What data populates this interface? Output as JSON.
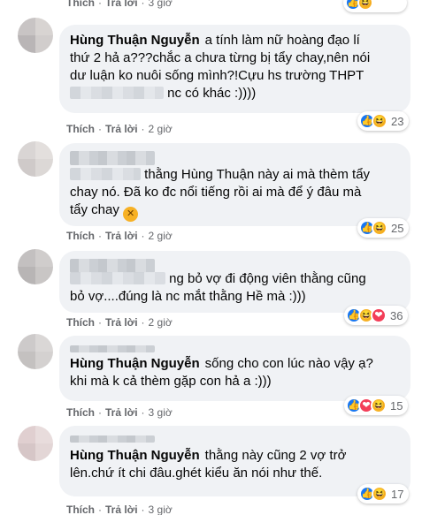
{
  "ui": {
    "like_label": "Thích",
    "reply_label": "Trả lời",
    "dot": "·",
    "time_label": "3 giờ",
    "time_label_2": "2 giờ"
  },
  "comments": [
    {
      "author": "Hùng Thuận Nguyễn",
      "line1": "a tính làm nữ hoàng đạo lí",
      "line2": "thứ 2 hả a???chắc a chưa từng bị tẩy chay,nên nói",
      "line3": "dư luận ko nuôi sống mình?!Cựu hs trường THPT",
      "line4": "nc có khác :))))",
      "reaction_count": "23",
      "time": "2 giờ"
    },
    {
      "author": "",
      "line1": "thằng Hùng Thuận này ai mà thèm tẩy",
      "line2": "chay nó. Đã ko đc nổi tiếng rồi ai mà để ý đâu mà",
      "line3": "tẩy chay",
      "reaction_count": "25",
      "time": "2 giờ"
    },
    {
      "author": "",
      "line1": "ng bỏ vợ đi động viên thằng cũng",
      "line2": "bỏ vợ....đúng là nc mắt thằng Hề mà :)))",
      "reaction_count": "36",
      "time": "2 giờ"
    },
    {
      "author": "Hùng Thuận Nguyễn",
      "line1": "sống cho con lúc nào vậy ạ?",
      "line2": "khi mà k cả thèm gặp con hả a :)))",
      "reaction_count": "15",
      "time": "3 giờ"
    },
    {
      "author": "Hùng Thuận Nguyễn",
      "line1": "thằng này cũng 2 vợ trở",
      "line2": "lên.chứ ít chi đâu.ghét kiểu ăn nói như thế.",
      "reaction_count": "17",
      "time": "3 giờ"
    }
  ],
  "colors": {
    "bubble": "#f0f2f5",
    "meta_text": "#65676b",
    "like": "#1877f2",
    "haha": "#f7b125",
    "love": "#f33e58"
  },
  "icons": {
    "like": "like-icon",
    "haha": "haha-icon",
    "love": "love-icon",
    "laugh_emoji": "grinning-squint-emoji"
  }
}
